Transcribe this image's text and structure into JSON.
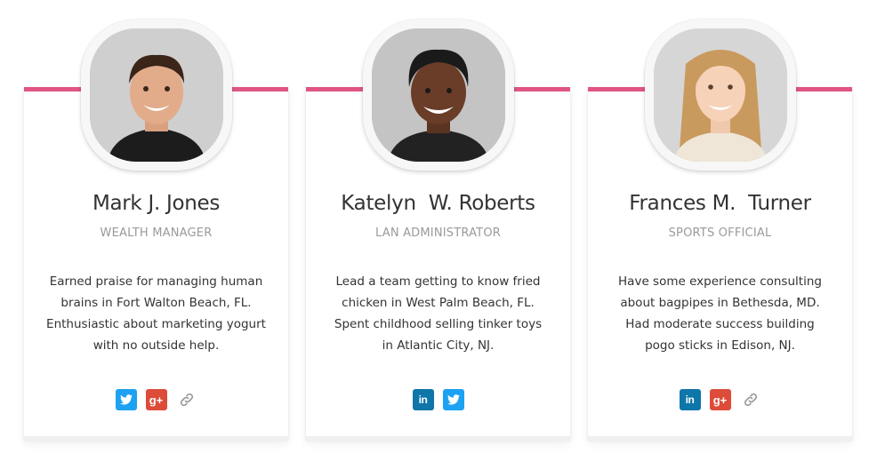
{
  "colors": {
    "accent": "#e05585",
    "twitter": "#1da1f2",
    "googleplus": "#dd4b39",
    "linkedin": "#0e76a8",
    "link": "#9a9a9a"
  },
  "team": [
    {
      "name": "Mark J. Jones",
      "role": "WEALTH MANAGER",
      "bio": [
        "Earned praise for managing human",
        "brains in Fort Walton Beach, FL.",
        "Enthusiastic about marketing yogurt",
        "with no outside help."
      ],
      "social": [
        "twitter-icon",
        "google-plus-icon",
        "link-icon"
      ],
      "gplus_text": "g+"
    },
    {
      "name": "Katelyn  W. Roberts",
      "role": "LAN ADMINISTRATOR",
      "bio": [
        "Lead a team getting to know fried",
        "chicken in West Palm Beach, FL.",
        "Spent childhood selling tinker toys",
        "in Atlantic City, NJ."
      ],
      "social": [
        "linkedin-icon",
        "twitter-icon"
      ],
      "linkedin_text": "in"
    },
    {
      "name": "Frances M.  Turner",
      "role": "SPORTS OFFICIAL",
      "bio": [
        "Have some experience consulting",
        "about bagpipes in Bethesda, MD.",
        "Had moderate success building",
        "pogo sticks in Edison, NJ."
      ],
      "social": [
        "linkedin-icon",
        "google-plus-icon",
        "link-icon"
      ],
      "linkedin_text": "in",
      "gplus_text": "g+"
    }
  ]
}
